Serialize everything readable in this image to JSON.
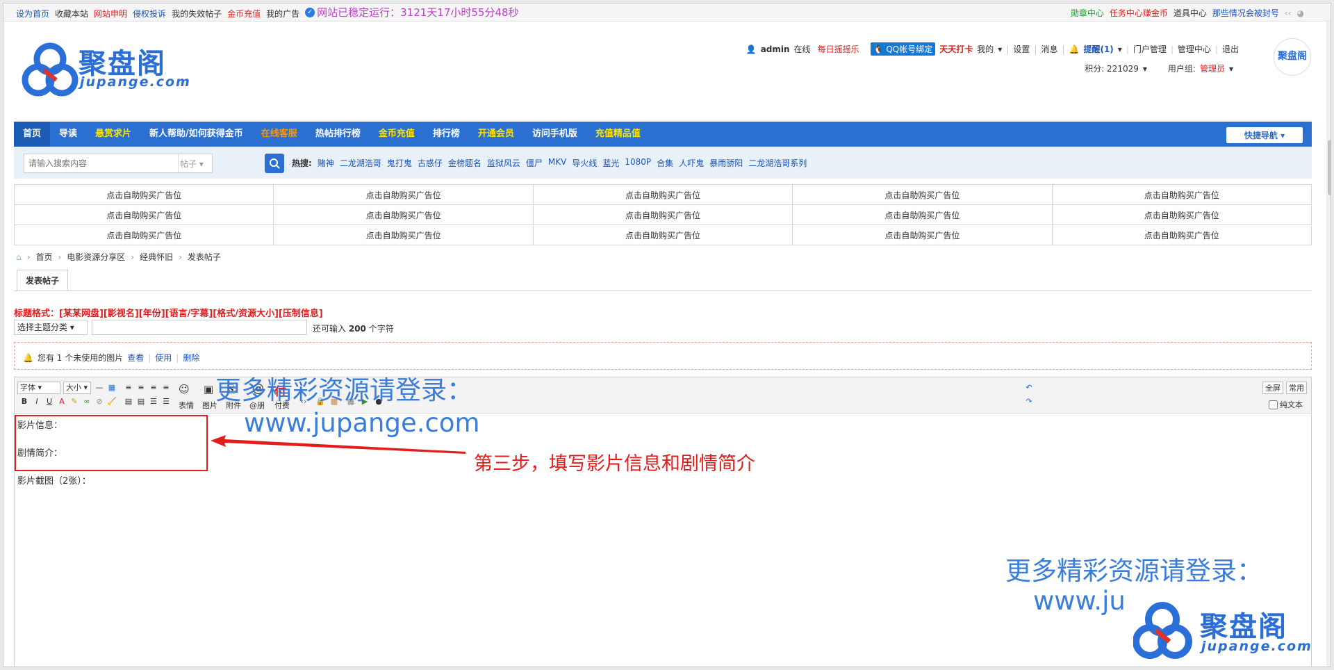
{
  "topbar": {
    "left_links": [
      "设为首页",
      "收藏本站",
      "网站申明",
      "侵权投诉",
      "我的失效帖子",
      "金币充值",
      "我的广告"
    ],
    "uptime": "网站已稳定运行：3121天17小时55分48秒",
    "right_links": [
      "勋章中心",
      "任务中心赚金币",
      "道具中心",
      "那些情况会被封号"
    ]
  },
  "logo": {
    "name": "聚盘阁",
    "domain": "jupange.com"
  },
  "user": {
    "name": "admin",
    "online": "在线",
    "daily": "每日摇摇乐",
    "qq_bind": "QQ帐号绑定",
    "checkin": "天天打卡",
    "my": "我的",
    "settings": "设置",
    "messages": "消息",
    "remind": "提醒(1)",
    "portal": "门户管理",
    "admin_center": "管理中心",
    "logout": "退出",
    "points": "积分: 221029",
    "group_label": "用户组:",
    "group": "管理员"
  },
  "nav": {
    "items": [
      "首页",
      "导读",
      "悬赏求片",
      "新人帮助/如何获得金币",
      "在线客服",
      "热帖排行榜",
      "金币充值",
      "排行榜",
      "开通会员",
      "访问手机版",
      "充值精品值"
    ],
    "quick": "快捷导航"
  },
  "search": {
    "placeholder": "请输入搜索内容",
    "type": "帖子",
    "hot_label": "热搜:",
    "hot_words": [
      "赌神",
      "二龙湖浩哥",
      "鬼打鬼",
      "古惑仔",
      "金榜题名",
      "监狱风云",
      "僵尸",
      "MKV",
      "导火线",
      "蓝光",
      "1080P",
      "合集",
      "人吓鬼",
      "暴雨骄阳",
      "二龙湖浩哥系列"
    ]
  },
  "ads": {
    "cell": "点击自助购买广告位"
  },
  "breadcrumb": [
    "首页",
    "电影资源分享区",
    "经典怀旧",
    "发表帖子"
  ],
  "post": {
    "tab": "发表帖子",
    "title_hint": "标题格式：[某某网盘][影视名][年份][语言/字幕][格式/资源大小][压制信息]",
    "topic_select": "选择主题分类",
    "remain_prefix": "还可输入",
    "remain_num": "200",
    "remain_suffix": "个字符",
    "notice": "您有 1 个未使用的图片",
    "notice_view": "查看",
    "notice_use": "使用",
    "notice_delete": "删除"
  },
  "editor": {
    "font": "字体",
    "size": "大小",
    "tools": [
      "表情",
      "图片",
      "附件",
      "@朋",
      "付费"
    ],
    "fullscreen": "全屏",
    "common": "常用",
    "plaintext": "纯文本",
    "lines": [
      "影片信息：",
      "",
      "剧情简介：",
      "",
      "影片截图（2张）："
    ]
  },
  "annotation": {
    "watermark_1": "更多精彩资源请登录：",
    "watermark_2": "www.jupange.com",
    "watermark_3": "更多精彩资源请登录：",
    "watermark_4": "www.ju",
    "step": "第三步，填写影片信息和剧情简介"
  },
  "colors": {
    "nav": "#2b70d0",
    "red": "#e41c1c",
    "blue": "#1a54b8",
    "watermark": "#2b73d8"
  }
}
